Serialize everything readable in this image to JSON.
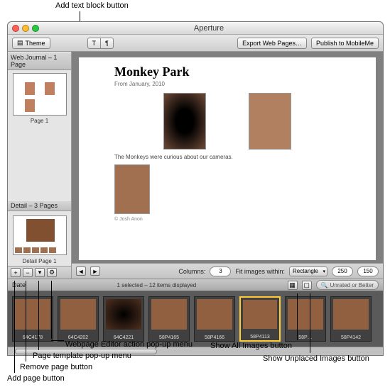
{
  "annotations": {
    "add_text_block": "Add text block button",
    "webpage_editor_menu": "Webpage Editor action pop-up menu",
    "page_template_menu": "Page template pop-up menu",
    "remove_page": "Remove page button",
    "add_page": "Add page button",
    "show_all_images": "Show All Images button",
    "show_unplaced": "Show Unplaced Images button"
  },
  "window": {
    "title": "Aperture"
  },
  "toolbar": {
    "theme_label": "Theme",
    "export_label": "Export Web Pages…",
    "publish_label": "Publish to MobileMe"
  },
  "sidebar": {
    "web_journal_head": "Web Journal – 1 Page",
    "page1_label": "Page 1",
    "detail_head": "Detail – 3 Pages",
    "detail_page_label": "Detail Page 1"
  },
  "page": {
    "title": "Monkey Park",
    "date": "From January, 2010",
    "caption": "The Monkeys were curious about our cameras.",
    "copyright": "© Josh Anon"
  },
  "canvas_footer": {
    "columns_label": "Columns:",
    "columns_value": "3",
    "fit_label": "Fit images within:",
    "fit_value": "Rectangle",
    "width": "250",
    "height": "150"
  },
  "filmstrip": {
    "date_label": "Date",
    "status": "1 selected – 12 items displayed",
    "filter_label": "Unrated or Better",
    "items": [
      {
        "label": "64C4178"
      },
      {
        "label": "64C4202"
      },
      {
        "label": "64C4221"
      },
      {
        "label": "58P4165"
      },
      {
        "label": "58P4166"
      },
      {
        "label": "58P4113"
      },
      {
        "label": "58P…"
      },
      {
        "label": "58P4142"
      }
    ]
  }
}
